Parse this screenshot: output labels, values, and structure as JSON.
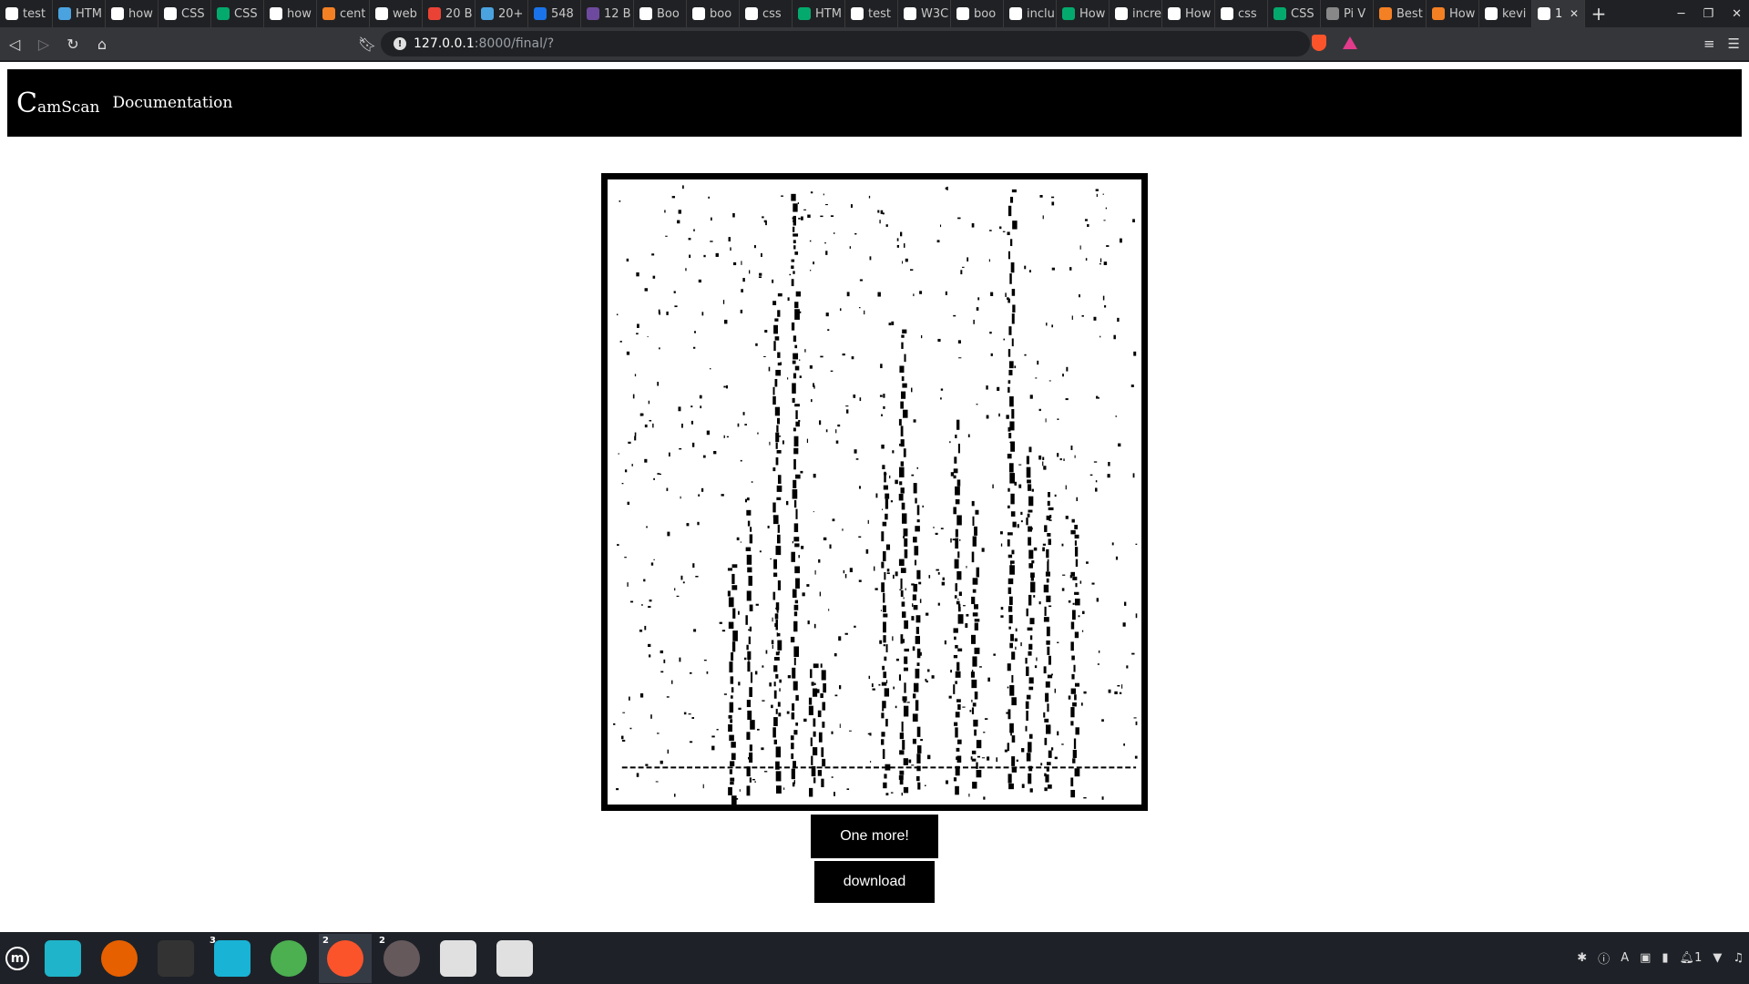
{
  "browser": {
    "tabs": [
      {
        "label": "test",
        "favicon": "google-icon",
        "color": "#ffffff"
      },
      {
        "label": "HTM",
        "favicon": "bookmark-tab-icon",
        "color": "#4aa3df"
      },
      {
        "label": "how",
        "favicon": "google-icon",
        "color": "#ffffff"
      },
      {
        "label": "CSS",
        "favicon": "w3schools-icon",
        "color": "#ffffff"
      },
      {
        "label": "CSS",
        "favicon": "w3schools-green-icon",
        "color": "#04aa6d"
      },
      {
        "label": "how",
        "favicon": "google-icon",
        "color": "#ffffff"
      },
      {
        "label": "cent",
        "favicon": "stackoverflow-icon",
        "color": "#f48024"
      },
      {
        "label": "web",
        "favicon": "google-icon",
        "color": "#ffffff"
      },
      {
        "label": "20 B",
        "favicon": "gmail-icon",
        "color": "#ea4335"
      },
      {
        "label": "20+",
        "favicon": "arrow-icon",
        "color": "#4aa3df"
      },
      {
        "label": "548",
        "favicon": "tm-icon",
        "color": "#1a73e8"
      },
      {
        "label": "12 B",
        "favicon": "purple-icon",
        "color": "#6e4a9e"
      },
      {
        "label": "Boo",
        "favicon": "openai-icon",
        "color": "#ffffff"
      },
      {
        "label": "boo",
        "favicon": "openai-icon",
        "color": "#ffffff"
      },
      {
        "label": "css",
        "favicon": "google-icon",
        "color": "#ffffff"
      },
      {
        "label": "HTM",
        "favicon": "w3schools-green-icon",
        "color": "#04aa6d"
      },
      {
        "label": "test",
        "favicon": "google-icon",
        "color": "#ffffff"
      },
      {
        "label": "W3C",
        "favicon": "w3c-icon",
        "color": "#ffffff"
      },
      {
        "label": "boo",
        "favicon": "openai-icon",
        "color": "#ffffff"
      },
      {
        "label": "inclu",
        "favicon": "google-icon",
        "color": "#ffffff"
      },
      {
        "label": "How",
        "favicon": "w3schools-green-icon",
        "color": "#04aa6d"
      },
      {
        "label": "incre",
        "favicon": "google-icon",
        "color": "#ffffff"
      },
      {
        "label": "How",
        "favicon": "openai-icon",
        "color": "#ffffff"
      },
      {
        "label": "css",
        "favicon": "google-icon",
        "color": "#ffffff"
      },
      {
        "label": "CSS",
        "favicon": "w3schools-green-icon",
        "color": "#04aa6d"
      },
      {
        "label": "Pi V",
        "favicon": "globe-icon",
        "color": "#888888"
      },
      {
        "label": "Best",
        "favicon": "stackoverflow-icon",
        "color": "#f48024"
      },
      {
        "label": "How",
        "favicon": "stackoverflow-icon",
        "color": "#f48024"
      },
      {
        "label": "kevi",
        "favicon": "github-icon",
        "color": "#ffffff"
      },
      {
        "label": "1",
        "favicon": "loading-icon",
        "color": "#ffffff",
        "active": true
      }
    ],
    "url_host": "127.0.0.1",
    "url_path": ":8000/final/?"
  },
  "site": {
    "brand_initial": "C",
    "brand_rest": "amScan",
    "nav_link": "Documentation"
  },
  "buttons": {
    "one_more": "One more!",
    "download": "download"
  },
  "taskbar": {
    "apps": [
      {
        "name": "show-desktop",
        "color": "#1fb4c9",
        "badge": ""
      },
      {
        "name": "firefox",
        "color": "#e66000",
        "badge": ""
      },
      {
        "name": "terminal",
        "color": "#333333",
        "badge": ""
      },
      {
        "name": "files",
        "color": "#19b3d6",
        "badge": "3"
      },
      {
        "name": "chrome",
        "color": "#4caf50",
        "badge": ""
      },
      {
        "name": "brave",
        "color": "#fb542b",
        "badge": "2",
        "active": true
      },
      {
        "name": "atom",
        "color": "#66595c",
        "badge": "2"
      },
      {
        "name": "text-editor",
        "color": "#e0e0e0",
        "badge": ""
      },
      {
        "name": "text-editor",
        "color": "#e0e0e0",
        "badge": ""
      }
    ],
    "tray_text": "1"
  }
}
